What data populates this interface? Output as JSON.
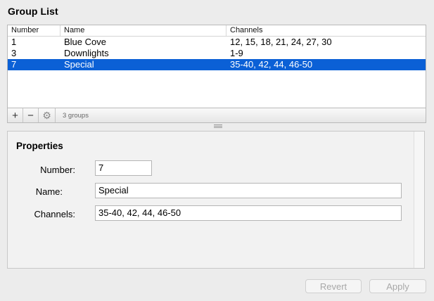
{
  "header": {
    "title": "Group List"
  },
  "table": {
    "columns": [
      "Number",
      "Name",
      "Channels"
    ],
    "rows": [
      {
        "number": "1",
        "name": "Blue Cove",
        "channels": "12, 15, 18, 21, 24, 27, 30",
        "selected": false
      },
      {
        "number": "3",
        "name": "Downlights",
        "channels": "1-9",
        "selected": false
      },
      {
        "number": "7",
        "name": "Special",
        "channels": "35-40, 42, 44, 46-50",
        "selected": true
      }
    ]
  },
  "toolbar": {
    "add_label": "+",
    "remove_label": "−",
    "gear_icon": "gear-icon",
    "count": "3 groups"
  },
  "properties": {
    "title": "Properties",
    "number_label": "Number:",
    "number_value": "7",
    "name_label": "Name:",
    "name_value": "Special",
    "channels_label": "Channels:",
    "channels_value": "35-40, 42, 44, 46-50"
  },
  "buttons": {
    "revert": "Revert",
    "apply": "Apply"
  },
  "colors": {
    "selection": "#0b60d6",
    "background": "#ececec"
  }
}
